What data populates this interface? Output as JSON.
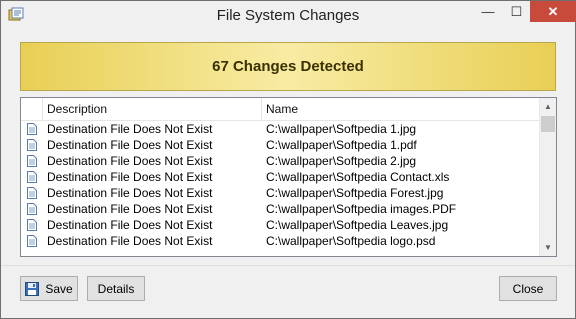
{
  "window": {
    "title": "File System Changes",
    "controls": {
      "minimize": "—",
      "maximize": "☐",
      "close": "✕"
    }
  },
  "banner": {
    "text": "67 Changes Detected"
  },
  "table": {
    "columns": {
      "description": "Description",
      "name": "Name"
    },
    "rows": [
      {
        "description": "Destination File Does Not Exist",
        "name": "C:\\wallpaper\\Softpedia 1.jpg"
      },
      {
        "description": "Destination File Does Not Exist",
        "name": "C:\\wallpaper\\Softpedia 1.pdf"
      },
      {
        "description": "Destination File Does Not Exist",
        "name": "C:\\wallpaper\\Softpedia 2.jpg"
      },
      {
        "description": "Destination File Does Not Exist",
        "name": "C:\\wallpaper\\Softpedia Contact.xls"
      },
      {
        "description": "Destination File Does Not Exist",
        "name": "C:\\wallpaper\\Softpedia Forest.jpg"
      },
      {
        "description": "Destination File Does Not Exist",
        "name": "C:\\wallpaper\\Softpedia images.PDF"
      },
      {
        "description": "Destination File Does Not Exist",
        "name": "C:\\wallpaper\\Softpedia Leaves.jpg"
      },
      {
        "description": "Destination File Does Not Exist",
        "name": "C:\\wallpaper\\Softpedia logo.psd"
      }
    ]
  },
  "buttons": {
    "save": "Save",
    "details": "Details",
    "close": "Close"
  },
  "icons": {
    "app": "app-icon",
    "row": "document-icon",
    "save": "floppy-disk-icon"
  }
}
